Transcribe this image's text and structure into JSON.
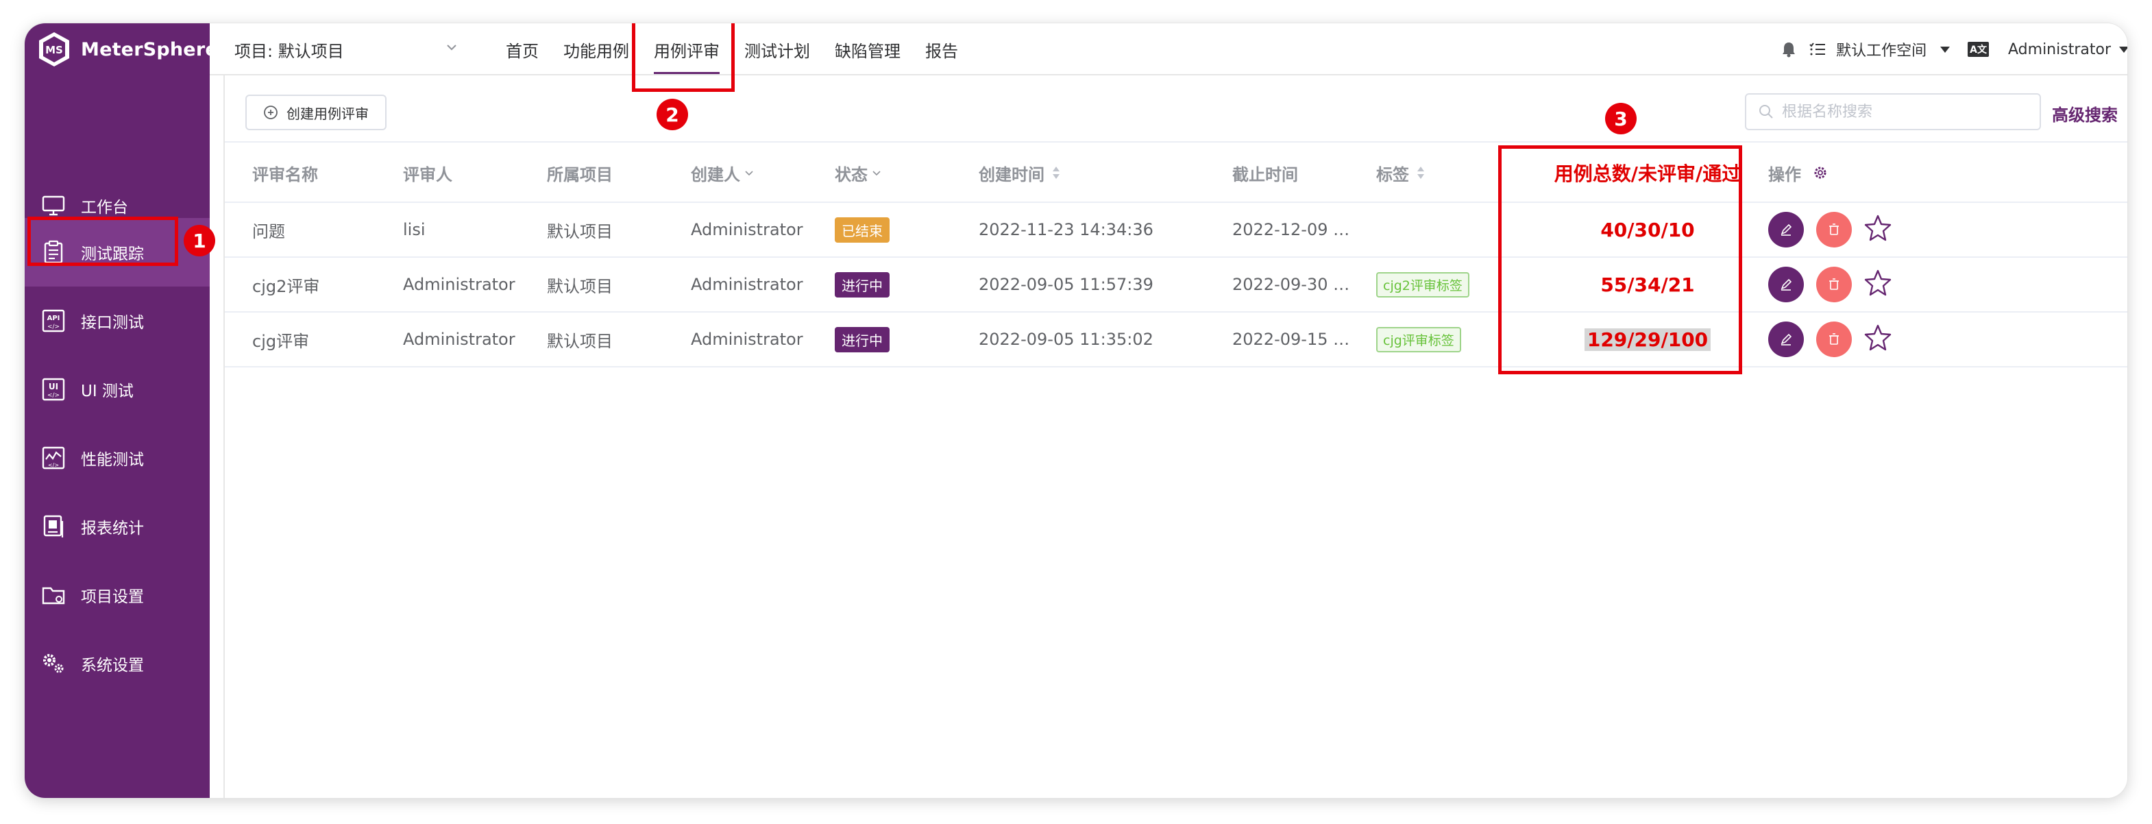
{
  "app": {
    "name": "MeterSphere"
  },
  "sidebar": {
    "items": [
      {
        "label": "工作台",
        "icon": "monitor-icon",
        "active": false
      },
      {
        "label": "测试跟踪",
        "icon": "clipboard-icon",
        "active": true
      },
      {
        "label": "接口测试",
        "icon": "api-icon",
        "active": false
      },
      {
        "label": "UI 测试",
        "icon": "ui-test-icon",
        "active": false
      },
      {
        "label": "性能测试",
        "icon": "performance-chart-icon",
        "active": false
      },
      {
        "label": "报表统计",
        "icon": "report-icon",
        "active": false
      },
      {
        "label": "项目设置",
        "icon": "folder-settings-icon",
        "active": false
      },
      {
        "label": "系统设置",
        "icon": "gears-icon",
        "active": false
      }
    ]
  },
  "topbar": {
    "project": "项目: 默认项目",
    "menu": [
      {
        "label": "首页",
        "active": false
      },
      {
        "label": "功能用例",
        "active": false
      },
      {
        "label": "用例评审",
        "active": true
      },
      {
        "label": "测试计划",
        "active": false
      },
      {
        "label": "缺陷管理",
        "active": false
      },
      {
        "label": "报告",
        "active": false
      }
    ],
    "workspace": "默认工作空间",
    "language_badge": "A文",
    "user": "Administrator"
  },
  "toolbar": {
    "create_label": "创建用例评审",
    "search_placeholder": "根据名称搜索",
    "advanced_search": "高级搜索"
  },
  "table": {
    "headers": {
      "name": "评审名称",
      "reviewer": "评审人",
      "project": "所属项目",
      "creator": "创建人",
      "status": "状态",
      "created": "创建时间",
      "deadline": "截止时间",
      "tags": "标签",
      "counts": "用例总数/未评审/通过",
      "ops": "操作"
    },
    "rows": [
      {
        "name": "问题",
        "reviewer": "lisi",
        "project": "默认项目",
        "creator": "Administrator",
        "status": "已结束",
        "status_color": "#e6a23c",
        "created": "2022-11-23 14:34:36",
        "deadline": "2022-12-09 …",
        "tag": "",
        "counts": "40/30/10",
        "highlight": false
      },
      {
        "name": "cjg2评审",
        "reviewer": "Administrator",
        "project": "默认项目",
        "creator": "Administrator",
        "status": "进行中",
        "status_color": "#652570",
        "created": "2022-09-05 11:57:39",
        "deadline": "2022-09-30 …",
        "tag": "cjg2评审标签",
        "counts": "55/34/21",
        "highlight": false
      },
      {
        "name": "cjg评审",
        "reviewer": "Administrator",
        "project": "默认项目",
        "creator": "Administrator",
        "status": "进行中",
        "status_color": "#652570",
        "created": "2022-09-05 11:35:02",
        "deadline": "2022-09-15 …",
        "tag": "cjg评审标签",
        "counts": "129/29/100",
        "highlight": true
      }
    ]
  },
  "annotations": {
    "one": "1",
    "two": "2",
    "three": "3"
  },
  "colors": {
    "brand": "#652570",
    "annotation": "#e5000a",
    "danger": "#f56c6c"
  }
}
